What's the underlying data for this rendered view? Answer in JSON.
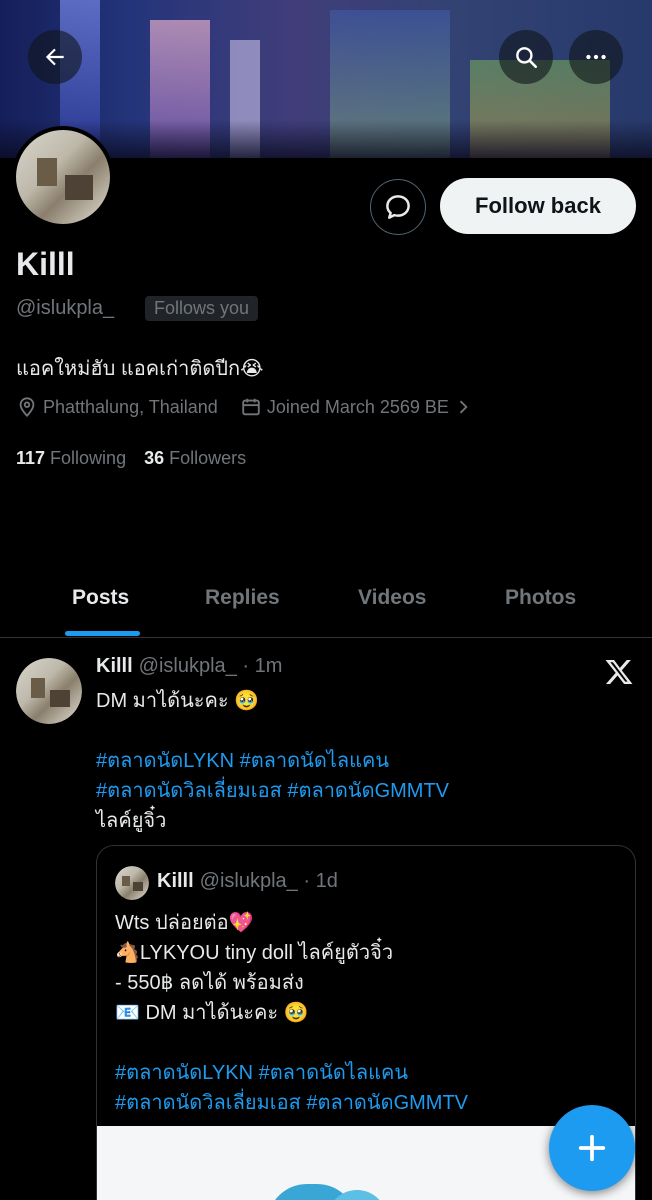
{
  "profile": {
    "display_name": "Killl",
    "handle": "@islukpla_",
    "follows_you_badge": "Follows you",
    "bio": "แอคใหม่ฮับ แอคเก่าติดปีก😭",
    "location": "Phatthalung, Thailand",
    "joined": "Joined March 2569 BE",
    "following_count": "117",
    "following_label": "Following",
    "followers_count": "36",
    "followers_label": "Followers",
    "follow_button_label": "Follow back"
  },
  "tabs": [
    {
      "label": "Posts",
      "active": true
    },
    {
      "label": "Replies",
      "active": false
    },
    {
      "label": "Videos",
      "active": false
    },
    {
      "label": "Photos",
      "active": false
    }
  ],
  "post": {
    "name": "Killl",
    "handle_time": "@islukpla_ · 1m",
    "line1": "DM มาได้นะคะ 🥹",
    "hashtags_line1": "#ตลาดนัดLYKN #ตลาดนัดไลแคน",
    "hashtags_line2": "#ตลาดนัดวิลเลี่ยมเอส #ตลาดนัดGMMTV",
    "line_last": "ไลค์ยูจิ๋ว",
    "quote": {
      "name": "Killl",
      "handle_time": "@islukpla_ · 1d",
      "line1": "Wts ปล่อยต่อ💖",
      "line2": "🐴LYKYOU tiny doll ไลค์ยูตัวจิ๋ว",
      "line3": "- 550฿ ลดได้ พร้อมส่ง",
      "line4": "📧 DM มาได้นะคะ 🥹",
      "hashtags_line1": "#ตลาดนัดLYKN #ตลาดนัดไลแคน",
      "hashtags_line2": "#ตลาดนัดวิลเลี่ยมเอส #ตลาดนัดGMMTV"
    }
  },
  "colors": {
    "accent": "#1d9bf0",
    "background": "#000000",
    "secondary_text": "#71767b"
  },
  "icons": [
    "back-arrow-icon",
    "search-icon",
    "more-icon",
    "message-icon",
    "location-icon",
    "calendar-icon",
    "chevron-right-icon",
    "x-logo-icon",
    "plus-icon"
  ]
}
